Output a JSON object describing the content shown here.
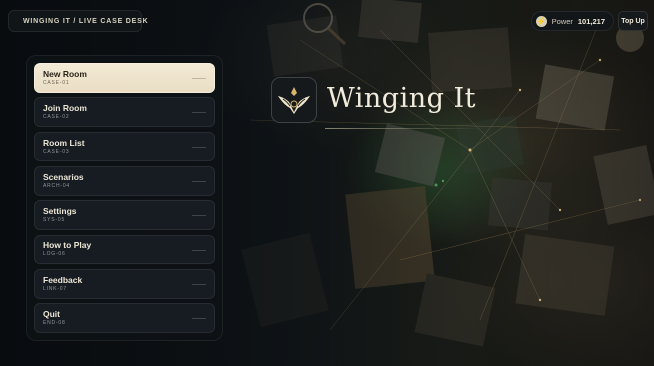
{
  "header": {
    "breadcrumb": "WINGING IT / LIVE CASE DESK",
    "power_label": "Power",
    "power_value": "101,217",
    "topup_label": "Top Up"
  },
  "menu": {
    "items": [
      {
        "label": "New Room",
        "code": "CASE-01",
        "active": true
      },
      {
        "label": "Join Room",
        "code": "CASE-02"
      },
      {
        "label": "Room List",
        "code": "CASE-03"
      },
      {
        "label": "Scenarios",
        "code": "ARCH-04"
      },
      {
        "label": "Settings",
        "code": "SYS-05"
      },
      {
        "label": "How to Play",
        "code": "LOG-06"
      },
      {
        "label": "Feedback",
        "code": "LINK-07"
      },
      {
        "label": "Quit",
        "code": "END-08"
      }
    ]
  },
  "hero": {
    "title": "Winging It"
  },
  "colors": {
    "accent": "#f3ead6",
    "panel": "#161c22",
    "gold": "#d9b56a"
  },
  "icons": {
    "logo": "winged-crest-icon",
    "power": "bolt-icon"
  }
}
